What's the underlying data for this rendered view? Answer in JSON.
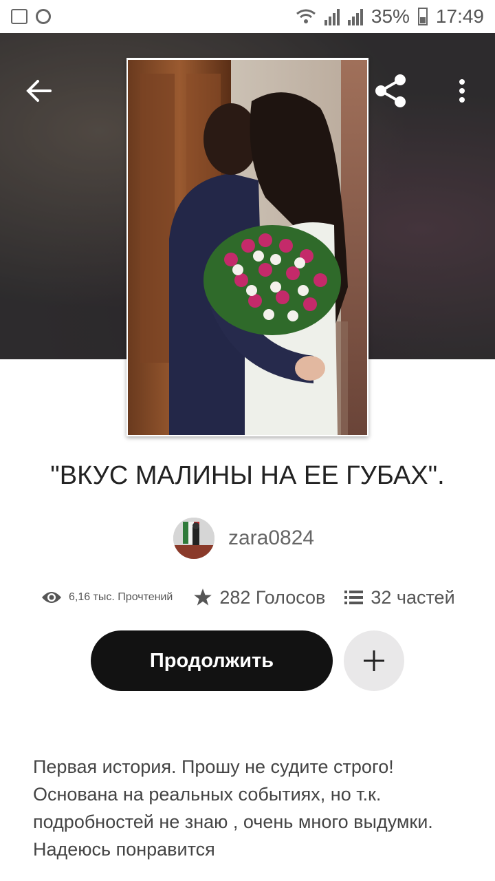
{
  "status_bar": {
    "battery": "35%",
    "time": "17:49"
  },
  "story": {
    "title": "\"ВКУС МАЛИНЫ НА ЕЕ ГУБАХ\".",
    "author": "zara0824",
    "reads": "6,16 тыс. Прочтений",
    "votes": "282 Голосов",
    "parts": "32 частей",
    "description_lines": [
      "Первая история. Прошу не судите строго!",
      "Основана на реальных событиях, но т.к.",
      "подробностей не знаю , очень много выдумки.",
      "Надеюсь понравится"
    ]
  },
  "actions": {
    "continue_label": "Продолжить"
  },
  "icons": {
    "back": "arrow-left-icon",
    "share": "share-icon",
    "more": "more-vertical-icon",
    "reads": "eye-icon",
    "votes": "star-icon",
    "parts": "list-icon",
    "add": "plus-icon"
  },
  "colors": {
    "button_dark": "#121212",
    "add_button_bg": "#e9e8e9",
    "text_primary": "#222222",
    "text_secondary": "#555555"
  }
}
